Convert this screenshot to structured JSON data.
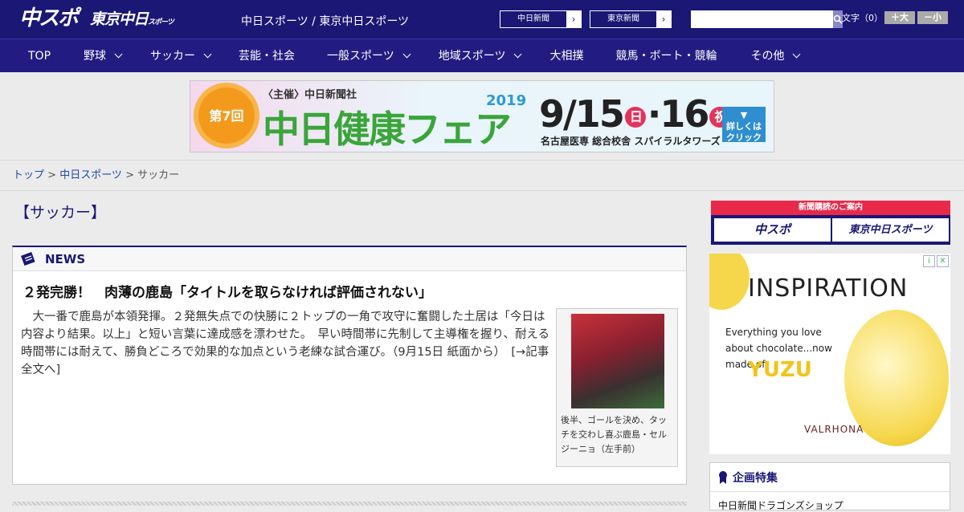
{
  "header": {
    "logo_main": "中スポ",
    "logo_tokyo": "東京中日",
    "logo_tokyo_small": "スポーツ",
    "site_name": "中日スポーツ / 東京中日スポーツ",
    "paper_buttons": [
      {
        "label": "中日新聞"
      },
      {
        "label": "東京新聞"
      }
    ],
    "search_placeholder": "",
    "font_label": "文字（0）",
    "font_bigger": "＋大",
    "font_smaller": "－小"
  },
  "nav": [
    {
      "label": "TOP",
      "has_menu": false
    },
    {
      "label": "野球",
      "has_menu": true
    },
    {
      "label": "サッカー",
      "has_menu": true
    },
    {
      "label": "芸能・社会",
      "has_menu": false
    },
    {
      "label": "一般スポーツ",
      "has_menu": true
    },
    {
      "label": "地域スポーツ",
      "has_menu": true
    },
    {
      "label": "大相撲",
      "has_menu": false
    },
    {
      "label": "競馬・ボート・競輪",
      "has_menu": false
    },
    {
      "label": "その他",
      "has_menu": true
    }
  ],
  "banner": {
    "badge": "第7回",
    "organizer": "〈主催〉中日新聞社",
    "title": "中日健康フェア",
    "year": "2019",
    "date_a": "9/15",
    "day_a": "日",
    "date_b": "16",
    "day_b": "祝",
    "venue": "名古屋医専 総合校舎 スパイラルタワーズ",
    "button": "詳しくはクリック"
  },
  "breadcrumb": {
    "home": "トップ",
    "section": "中日スポーツ",
    "current": "サッカー",
    "sep": " > "
  },
  "main": {
    "category_title": "【サッカー】",
    "news_label": "NEWS",
    "headline": "２発完勝！　肉薄の鹿島「タイトルを取らなければ評価されない」",
    "body": "　大一番で鹿島が本領発揮。２発無失点での快勝に２トップの一角で攻守に奮闘した土居は「今日は内容より結果。以上」と短い言葉に達成感を漂わせた。　早い時間帯に先制して主導権を握り、耐える時間帯には耐えて、勝負どころで効果的な加点という老練な試合運び。（9月15日 紙面から）　[→記事全文へ]",
    "photo_caption": "後半、ゴールを決め、タッチを交わし喜ぶ鹿島・セルジーニョ（左手前）"
  },
  "sidebar": {
    "subscribe_title": "新聞購読のご案内",
    "subscribe_a": "中スポ",
    "subscribe_b": "東京中日スポーツ",
    "ad": {
      "headline": "INSPIRATION",
      "text": "Everything you love about chocolate...now made of",
      "flavor": "YUZU",
      "brand": "VALRHONA"
    },
    "feature_title": "企画特集",
    "feature_item": "中日新聞ドラゴンズショップ"
  },
  "colors": {
    "header_bg": "#1a1775",
    "accent_red": "#e9294a",
    "link": "#1a4aa8"
  }
}
